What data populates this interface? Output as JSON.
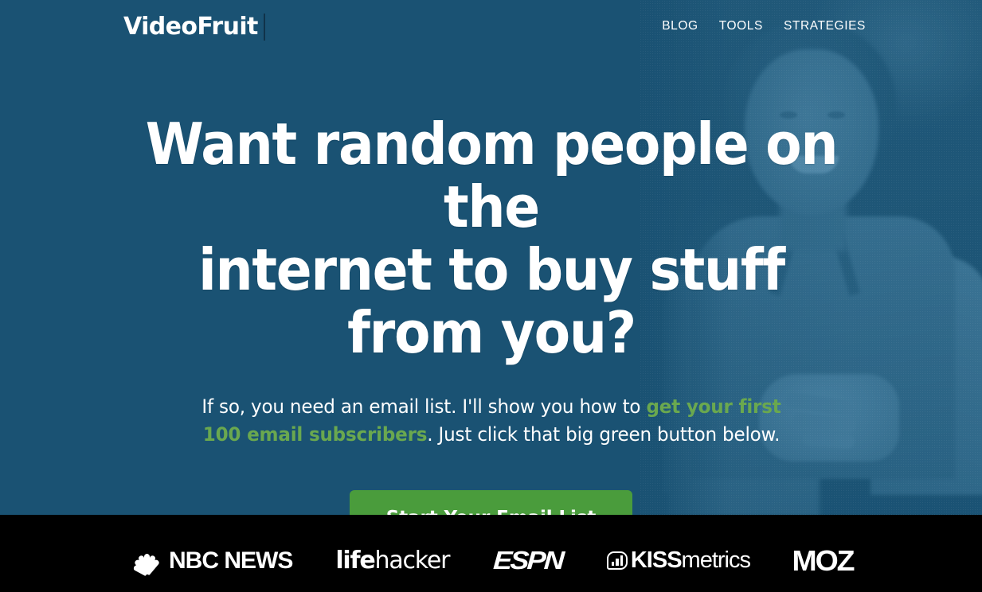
{
  "brand": {
    "logo_text": "VideoFruit",
    "accent_green": "#4a9c3c",
    "text_green": "#6aa84f",
    "hero_blue": "#1a5273",
    "bar_black": "#000000"
  },
  "nav": {
    "items": [
      {
        "label": "BLOG"
      },
      {
        "label": "TOOLS"
      },
      {
        "label": "STRATEGIES"
      }
    ]
  },
  "hero": {
    "headline_line1": "Want random people on the",
    "headline_line2": "internet to buy stuff from you?",
    "subhead_part1": "If so, you need an email list. I'll show you how to ",
    "subhead_highlight": "get your first 100 email subscribers",
    "subhead_part2": ". Just click that big green button below.",
    "cta_label": "Start Your Email List",
    "photo_alt": "smiling-man-blue-duotone-photo"
  },
  "logobar": {
    "items": [
      {
        "name": "nbc-news",
        "text": "NBC NEWS",
        "icon": "nbc-peacock-icon"
      },
      {
        "name": "lifehacker",
        "bold": "life",
        "regular": "hacker"
      },
      {
        "name": "espn",
        "text": "ESPN"
      },
      {
        "name": "kissmetrics",
        "bold": "KISS",
        "regular": "metrics",
        "icon": "kissmetrics-bar-chart-icon"
      },
      {
        "name": "moz",
        "text": "MOZ"
      }
    ]
  }
}
